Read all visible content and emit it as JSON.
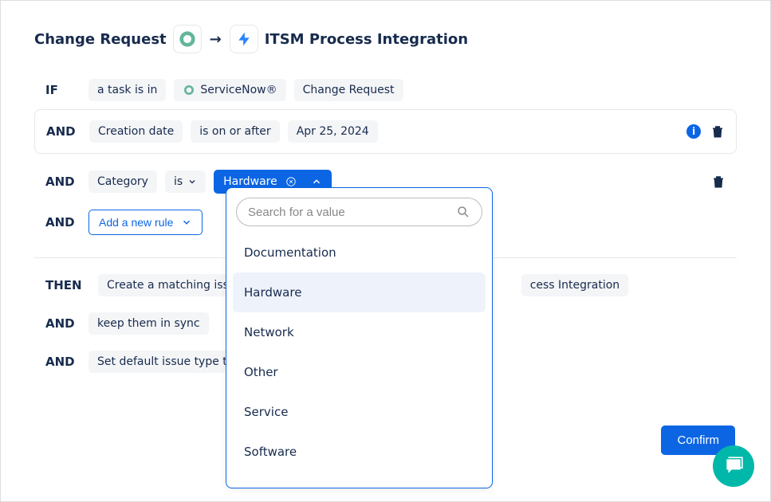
{
  "header": {
    "source": "Change Request",
    "target": "ITSM Process Integration"
  },
  "rules": {
    "if": {
      "kw": "IF",
      "chips": [
        "a task is in",
        "ServiceNow®",
        "Change Request"
      ]
    },
    "and1": {
      "kw": "AND",
      "field": "Creation date",
      "op": "is on or after",
      "val": "Apr 25, 2024"
    },
    "and2": {
      "kw": "AND",
      "field": "Category",
      "op": "is",
      "val": "Hardware"
    },
    "and3": {
      "kw": "AND",
      "add_label": "Add a new rule"
    }
  },
  "then": {
    "r1": {
      "kw": "THEN",
      "text": "Create a matching issue i",
      "tail": "cess Integration"
    },
    "r2": {
      "kw": "AND",
      "text": "keep them in sync"
    },
    "r3": {
      "kw": "AND",
      "text": "Set default issue type to"
    }
  },
  "dropdown": {
    "placeholder": "Search for a value",
    "options": [
      "Documentation",
      "Hardware",
      "Network",
      "Other",
      "Service",
      "Software"
    ],
    "selected": "Hardware"
  },
  "confirm_label": "Confirm"
}
